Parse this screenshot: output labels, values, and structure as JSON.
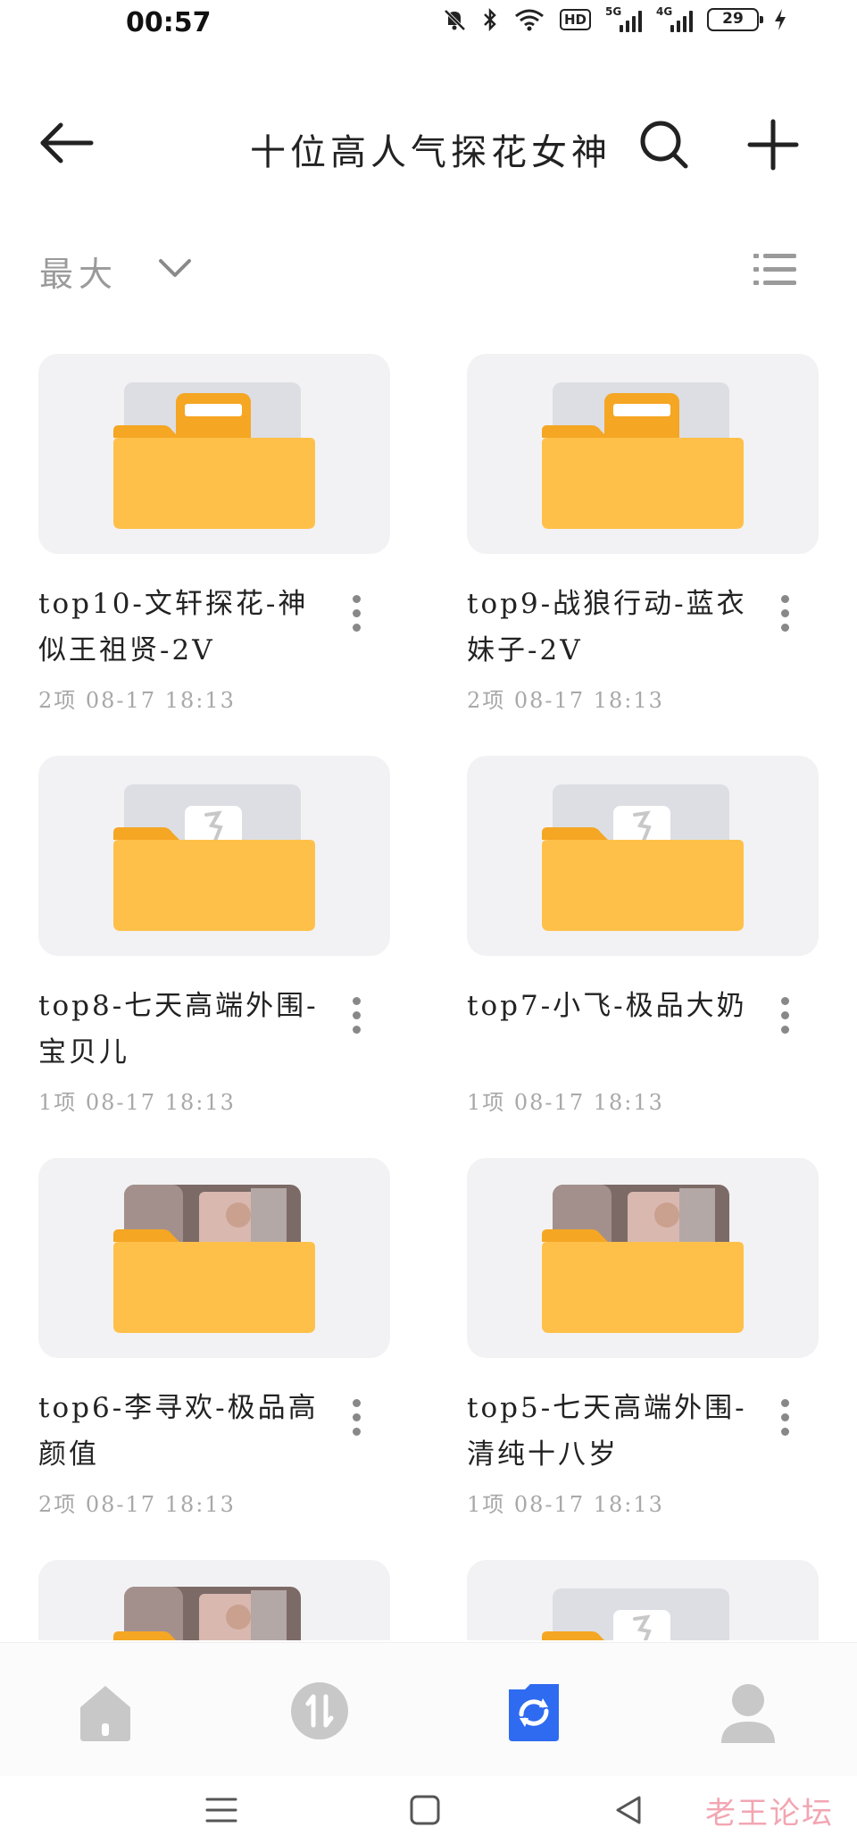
{
  "status_bar": {
    "time": "00:57",
    "signal1_label": "5G",
    "signal2_label": "4G",
    "hd_label": "HD",
    "battery": "29"
  },
  "header": {
    "title": "十位高人气探花女神",
    "back_icon": "back-arrow-icon",
    "search_icon": "search-icon",
    "add_icon": "plus-icon"
  },
  "sort": {
    "label": "最大",
    "view_icon": "list-view-icon"
  },
  "folders": [
    {
      "name": "top10-文轩探花-神似王祖贤-2V",
      "meta": "2项  08-17 18:13",
      "thumb": "folder-doc"
    },
    {
      "name": "top9-战狼行动-蓝衣妹子-2V",
      "meta": "2项  08-17 18:13",
      "thumb": "folder-doc"
    },
    {
      "name": "top8-七天高端外围-宝贝儿",
      "meta": "1项  08-17 18:13",
      "thumb": "folder-video"
    },
    {
      "name": "top7-小飞-极品大奶",
      "meta": "1项  08-17 18:13",
      "thumb": "folder-video"
    },
    {
      "name": "top6-李寻欢-极品高颜值",
      "meta": "2项  08-17 18:13",
      "thumb": "folder-photo"
    },
    {
      "name": "top5-七天高端外围-清纯十八岁",
      "meta": "1项  08-17 18:13",
      "thumb": "folder-photo"
    },
    {
      "name": "",
      "meta": "",
      "thumb": "folder-photo"
    },
    {
      "name": "",
      "meta": "",
      "thumb": "folder-video"
    }
  ],
  "bottom_nav": [
    {
      "icon": "home-icon",
      "active": false
    },
    {
      "icon": "transfer-icon",
      "active": false
    },
    {
      "icon": "files-icon",
      "active": true
    },
    {
      "icon": "profile-icon",
      "active": false
    }
  ],
  "colors": {
    "folder": "#ffc04a",
    "folder_back": "#f5a623",
    "active_nav": "#2f6bf0",
    "inactive_nav": "#c8c8c8",
    "text_secondary": "#a8a8a8"
  },
  "watermark": "老王论坛"
}
